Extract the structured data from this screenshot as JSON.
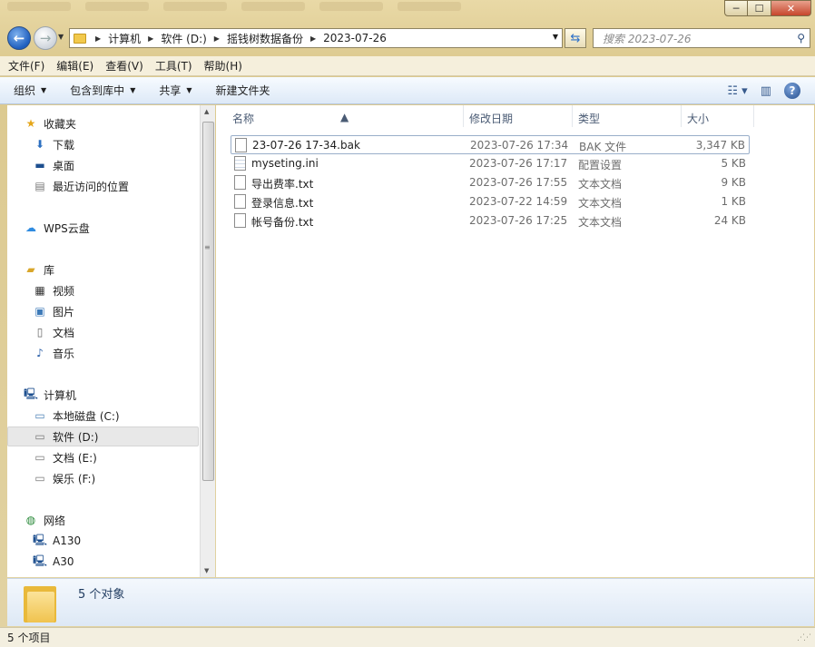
{
  "window": {
    "controls": {
      "minimize": "─",
      "maximize": "☐",
      "close": "✕"
    }
  },
  "nav": {
    "breadcrumbs": [
      "计算机",
      "软件 (D:)",
      "摇钱树数据备份",
      "2023-07-26"
    ],
    "search_placeholder": "搜索 2023-07-26"
  },
  "menubar": {
    "items": [
      "文件(F)",
      "编辑(E)",
      "查看(V)",
      "工具(T)",
      "帮助(H)"
    ]
  },
  "toolbar": {
    "organize": "组织",
    "include_library": "包含到库中",
    "share": "共享",
    "new_folder": "新建文件夹"
  },
  "sidebar": {
    "favorites": "收藏夹",
    "downloads": "下载",
    "desktop": "桌面",
    "recent": "最近访问的位置",
    "wps_cloud": "WPS云盘",
    "libraries": "库",
    "videos": "视频",
    "pictures": "图片",
    "documents": "文档",
    "music": "音乐",
    "computer": "计算机",
    "drive_c": "本地磁盘 (C:)",
    "drive_d": "软件 (D:)",
    "drive_e": "文档 (E:)",
    "drive_f": "娱乐 (F:)",
    "network": "网络",
    "net_a130": "A130",
    "net_a30": "A30"
  },
  "columns": {
    "name": "名称",
    "date": "修改日期",
    "type": "类型",
    "size": "大小"
  },
  "files": [
    {
      "name": "23-07-26 17-34.bak",
      "date": "2023-07-26 17:34",
      "type": "BAK 文件",
      "size": "3,347 KB"
    },
    {
      "name": "myseting.ini",
      "date": "2023-07-26 17:17",
      "type": "配置设置",
      "size": "5 KB"
    },
    {
      "name": "导出费率.txt",
      "date": "2023-07-26 17:55",
      "type": "文本文档",
      "size": "9 KB"
    },
    {
      "name": "登录信息.txt",
      "date": "2023-07-22 14:59",
      "type": "文本文档",
      "size": "1 KB"
    },
    {
      "name": "帐号备份.txt",
      "date": "2023-07-26 17:25",
      "type": "文本文档",
      "size": "24 KB"
    }
  ],
  "details": {
    "object_count": "5 个对象"
  },
  "status": {
    "item_count": "5 个项目"
  }
}
